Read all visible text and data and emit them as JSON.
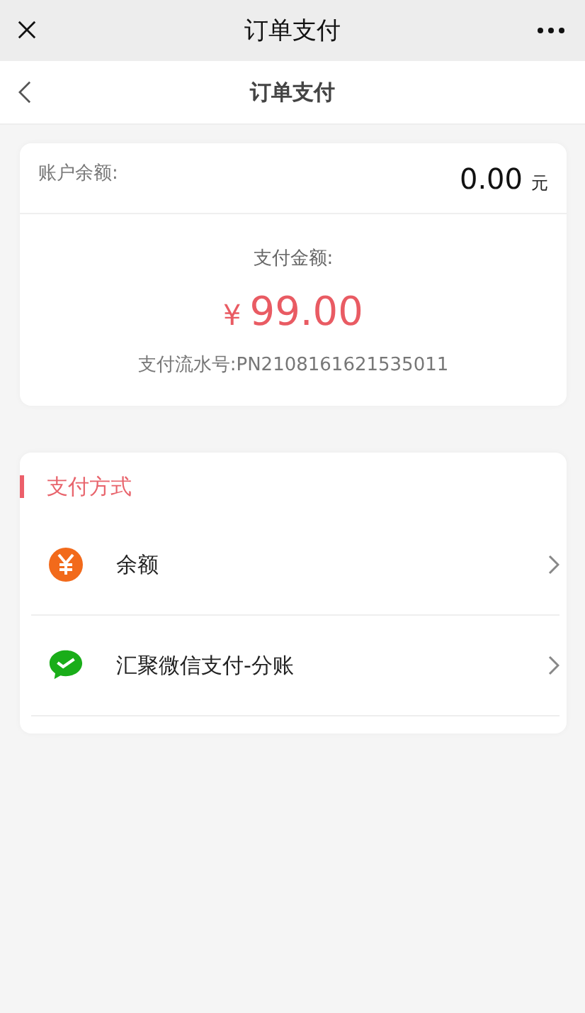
{
  "window": {
    "title": "订单支付"
  },
  "nav": {
    "title": "订单支付"
  },
  "account": {
    "label": "账户余额:",
    "balance": "0.00",
    "unit": "元"
  },
  "payment": {
    "label": "支付金额:",
    "currency": "¥",
    "amount": "99.00",
    "serial": "支付流水号:PN2108161621535011"
  },
  "methods_section": {
    "title": "支付方式",
    "methods": [
      {
        "kind": "balance",
        "label": "余额"
      },
      {
        "kind": "wechat",
        "label": "汇聚微信支付-分账"
      }
    ]
  }
}
